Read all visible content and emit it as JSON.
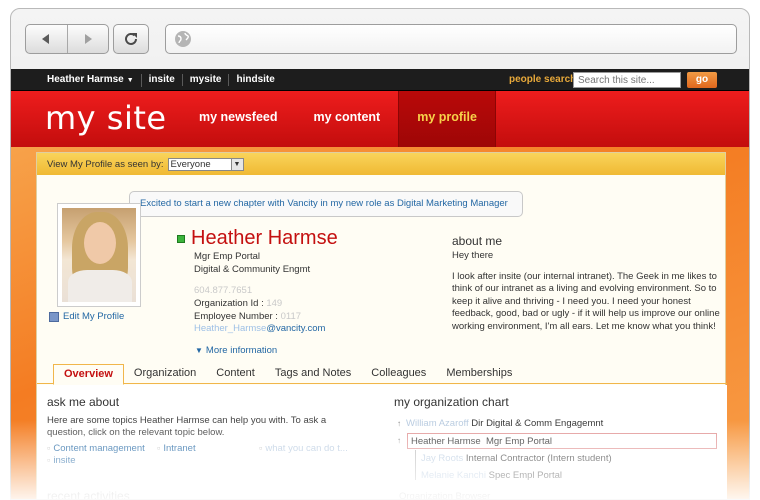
{
  "browser": {
    "address_value": ""
  },
  "topbar": {
    "user_menu": "Heather Harmse",
    "links": [
      "insite",
      "mysite",
      "hindsite"
    ],
    "people_search_label": "people search",
    "search_placeholder": "Search this site...",
    "go_label": "go"
  },
  "header": {
    "site_title": "my site",
    "tabs": [
      "my newsfeed",
      "my content",
      "my profile"
    ],
    "active_tab": "my profile"
  },
  "view_bar": {
    "label": "View My Profile as seen by:",
    "selected": "Everyone"
  },
  "status_message": "Excited to start a new chapter with Vancity in my new role as Digital Marketing Manager",
  "profile": {
    "edit_label": "Edit My Profile",
    "name": "Heather Harmse",
    "title_line1": "Mgr Emp Portal",
    "title_line2": "Digital & Community Engmt",
    "phone": "604.877.7651",
    "org_id_label": "Organization Id :",
    "org_id_value": "149",
    "employee_number_label": "Employee Number :",
    "employee_number_value": "0117",
    "email_local": "Heather_Harmse",
    "email_domain": "@vancity.com",
    "more_info": "More information"
  },
  "about": {
    "heading": "about me",
    "subheading": "Hey there",
    "body": "I look after insite (our internal intranet). The Geek in me likes to think of our intranet as a living and evolving environment. So to keep it alive and thriving - I need you.  I need your honest feedback, good, bad or ugly - if it will help us improve our online working environment, I'm all ears. Let me know what you think!"
  },
  "tabs": [
    "Overview",
    "Organization",
    "Content",
    "Tags and Notes",
    "Colleagues",
    "Memberships"
  ],
  "active_profile_tab": "Overview",
  "ask_me": {
    "heading": "ask me about",
    "text": "Here are some topics Heather Harmse can help you with. To ask a question, click on the relevant topic below.",
    "topics": [
      "Content management",
      "Intranet",
      "what you can do t...",
      "insite"
    ]
  },
  "recent": {
    "heading": "recent activities"
  },
  "org_chart": {
    "heading": "my organization chart",
    "manager_name": "William Azaroff",
    "manager_title": "Dir Digital & Comm Engagemnt",
    "self_name": "Heather Harmse",
    "self_title": "Mgr Emp Portal",
    "reports": [
      {
        "name": "Jay Roots",
        "title": "Internal Contractor (Intern student)"
      },
      {
        "name": "Melanie Kanchi",
        "title": "Spec Empl Portal"
      }
    ],
    "footer": "Organization Browser"
  }
}
